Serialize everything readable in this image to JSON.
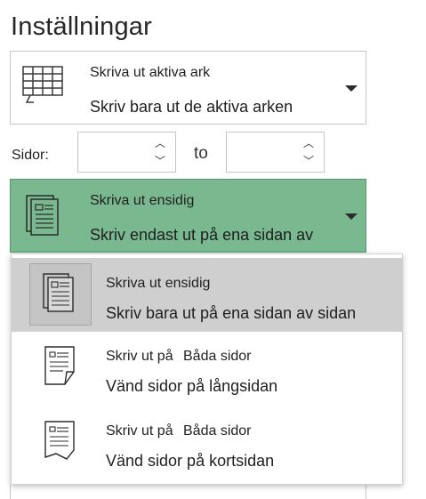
{
  "settings": {
    "title": "Inställningar"
  },
  "print_what": {
    "label": "Skriva ut aktiva ark",
    "description": "Skriv bara ut de aktiva arken"
  },
  "pages": {
    "label": "Sidor:",
    "from_value": "",
    "to_label": "to",
    "to_value": ""
  },
  "sides": {
    "label": "Skriva ut ensidig",
    "description": "Skriv endast ut på ena sidan av",
    "options": [
      {
        "label": "Skriva ut ensidig",
        "label2": "",
        "description": "Skriv bara ut på ena sidan av sidan",
        "selected": true
      },
      {
        "label": "Skriv ut på",
        "label2": "Båda sidor",
        "description": "Vänd sidor på långsidan",
        "selected": false
      },
      {
        "label": "Skriv ut på",
        "label2": "Båda sidor",
        "description": "Vänd sidor på kortsidan",
        "selected": false
      }
    ]
  },
  "icons": {
    "print_what": "spreadsheet-grid-icon",
    "sides": "single-sided-page-icon",
    "option_0": "single-sided-page-icon",
    "option_1": "flip-long-edge-icon",
    "option_2": "flip-short-edge-icon",
    "caret": "chevron-down-icon"
  },
  "colors": {
    "selected_dropdown_bg": "#7ab890",
    "selected_dropdown_border": "#4e9a6d",
    "highlighted_option_bg": "#cfcfcf"
  }
}
